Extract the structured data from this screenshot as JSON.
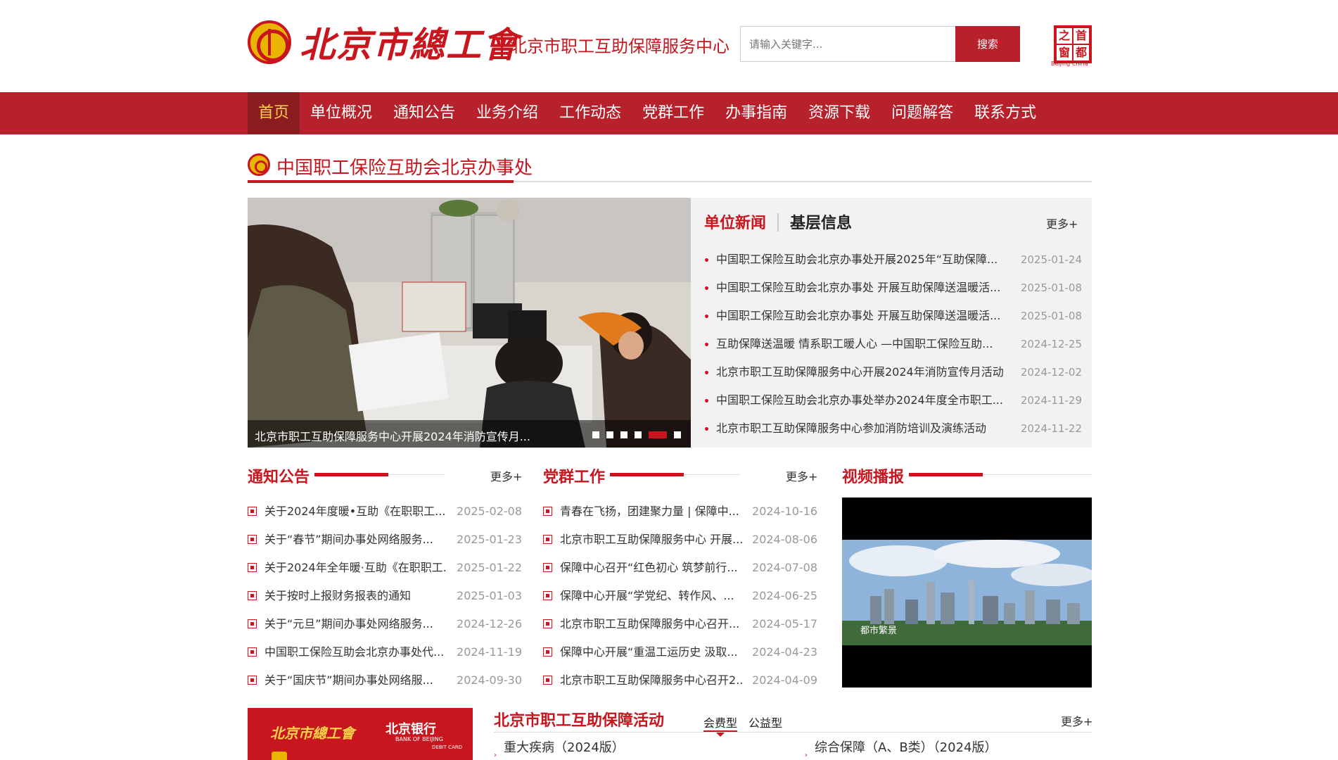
{
  "header": {
    "brand_title": "北京市總工會",
    "subtitle": "北京市职工互助保障服务中心",
    "search_placeholder": "请输入关键字...",
    "search_button": "搜索",
    "capital_seal": [
      "之",
      "首",
      "窗",
      "都"
    ],
    "capital_seal_en": "Beijing·China"
  },
  "nav": {
    "items": [
      "首页",
      "单位概况",
      "通知公告",
      "业务介绍",
      "工作动态",
      "党群工作",
      "办事指南",
      "资源下载",
      "问题解答",
      "联系方式"
    ],
    "active_index": 0
  },
  "section_title": "中国职工保险互助会北京办事处",
  "slider": {
    "caption": "北京市职工互助保障服务中心开展2024年消防宣传月...",
    "dot_count": 6,
    "active_dot": 4
  },
  "news_panel": {
    "tab_active": "单位新闻",
    "tab_other": "基层信息",
    "more": "更多+",
    "items": [
      {
        "title": "中国职工保险互助会北京办事处开展2025年“互助保障...",
        "date": "2025-01-24"
      },
      {
        "title": "中国职工保险互助会北京办事处 开展互助保障送温暖活...",
        "date": "2025-01-08"
      },
      {
        "title": "中国职工保险互助会北京办事处 开展互助保障送温暖活...",
        "date": "2025-01-08"
      },
      {
        "title": "互助保障送温暖 情系职工暖人心 —中国职工保险互助...",
        "date": "2024-12-25"
      },
      {
        "title": "北京市职工互助保障服务中心开展2024年消防宣传月活动",
        "date": "2024-12-02"
      },
      {
        "title": "中国职工保险互助会北京办事处举办2024年度全市职工...",
        "date": "2024-11-29"
      },
      {
        "title": "北京市职工互助保障服务中心参加消防培训及演练活动",
        "date": "2024-11-22"
      }
    ]
  },
  "notice": {
    "title": "通知公告",
    "more": "更多+",
    "items": [
      {
        "title": "关于2024年度暖•互助《在职职工...",
        "date": "2025-02-08"
      },
      {
        "title": "关于“春节”期间办事处网络服务...",
        "date": "2025-01-23"
      },
      {
        "title": "关于2024年全年暖·互助《在职职工...",
        "date": "2025-01-22"
      },
      {
        "title": "关于按时上报财务报表的通知",
        "date": "2025-01-03"
      },
      {
        "title": "关于“元旦”期间办事处网络服务...",
        "date": "2024-12-26"
      },
      {
        "title": "中国职工保险互助会北京办事处代...",
        "date": "2024-11-19"
      },
      {
        "title": "关于“国庆节”期间办事处网络服...",
        "date": "2024-09-30"
      }
    ]
  },
  "party": {
    "title": "党群工作",
    "more": "更多+",
    "items": [
      {
        "title": "青春在飞扬，团建聚力量 | 保障中...",
        "date": "2024-10-16"
      },
      {
        "title": "北京市职工互助保障服务中心 开展...",
        "date": "2024-08-06"
      },
      {
        "title": "保障中心召开“红色初心 筑梦前行...",
        "date": "2024-07-08"
      },
      {
        "title": "保障中心开展“学党纪、转作风、...",
        "date": "2024-06-25"
      },
      {
        "title": "北京市职工互助保障服务中心召开...",
        "date": "2024-05-17"
      },
      {
        "title": "保障中心开展“重温工运历史 汲取...",
        "date": "2024-04-23"
      },
      {
        "title": "北京市职工互助保障服务中心召开2...",
        "date": "2024-04-09"
      }
    ]
  },
  "video": {
    "title": "视频播报",
    "caption": "都市繁景"
  },
  "bank_card": {
    "union_text": "北京市總工會",
    "bank_name": "北京银行",
    "bank_en": "BANK OF BEIJING",
    "card_type": "DEBIT CARD"
  },
  "activities": {
    "title": "北京市职工互助保障活动",
    "tab_active": "会费型",
    "tab_other": "公益型",
    "more": "更多+",
    "items": [
      "重大疾病（2024版）",
      "综合保障（A、B类）（2024版）"
    ]
  },
  "colors": {
    "brand_red": "#b6212b",
    "nav_active_bg": "#8c1c20",
    "nav_active_text": "#ffd24a",
    "gold": "#e8b400"
  }
}
